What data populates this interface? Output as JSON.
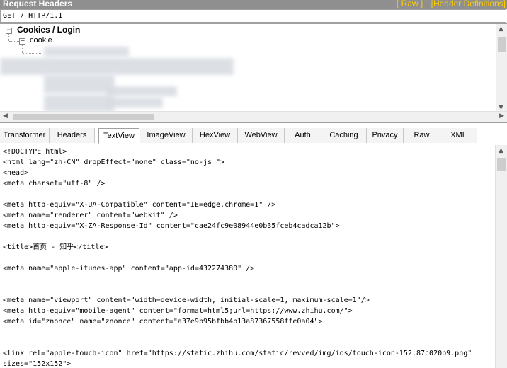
{
  "header": {
    "title": "Request Headers",
    "raw_link": "[ Raw ]",
    "definitions_link": "[Header Definitions]"
  },
  "request_line": "GET / HTTP/1.1",
  "tree": {
    "group_label": "Cookies / Login",
    "child_label": "cookie"
  },
  "tabs": [
    {
      "label": "Transformer"
    },
    {
      "label": "Headers"
    },
    {
      "label": "TextView"
    },
    {
      "label": "ImageView"
    },
    {
      "label": "HexView"
    },
    {
      "label": "WebView"
    },
    {
      "label": "Auth"
    },
    {
      "label": "Caching"
    },
    {
      "label": "Privacy"
    },
    {
      "label": "Raw"
    },
    {
      "label": "XML"
    }
  ],
  "active_tab": "TextView",
  "code_lines": [
    "<!DOCTYPE html>",
    "<html lang=\"zh-CN\" dropEffect=\"none\" class=\"no-js \">",
    "<head>",
    "<meta charset=\"utf-8\" />",
    "",
    "<meta http-equiv=\"X-UA-Compatible\" content=\"IE=edge,chrome=1\" />",
    "<meta name=\"renderer\" content=\"webkit\" />",
    "<meta http-equiv=\"X-ZA-Response-Id\" content=\"cae24fc9e08944e0b35fceb4cadca12b\">",
    "",
    "<title>首页 - 知乎</title>",
    "",
    "<meta name=\"apple-itunes-app\" content=\"app-id=432274380\" />",
    "",
    "",
    "<meta name=\"viewport\" content=\"width=device-width, initial-scale=1, maximum-scale=1\"/>",
    "<meta http-equiv=\"mobile-agent\" content=\"format=html5;url=https://www.zhihu.com/\">",
    "<meta id=\"znonce\" name=\"znonce\" content=\"a37e9b95bfbb4b13a87367558ffe0a04\">",
    "",
    "",
    "<link rel=\"apple-touch-icon\" href=\"https://static.zhihu.com/static/revved/img/ios/touch-icon-152.87c020b9.png\"",
    "sizes=\"152x152\">"
  ]
}
